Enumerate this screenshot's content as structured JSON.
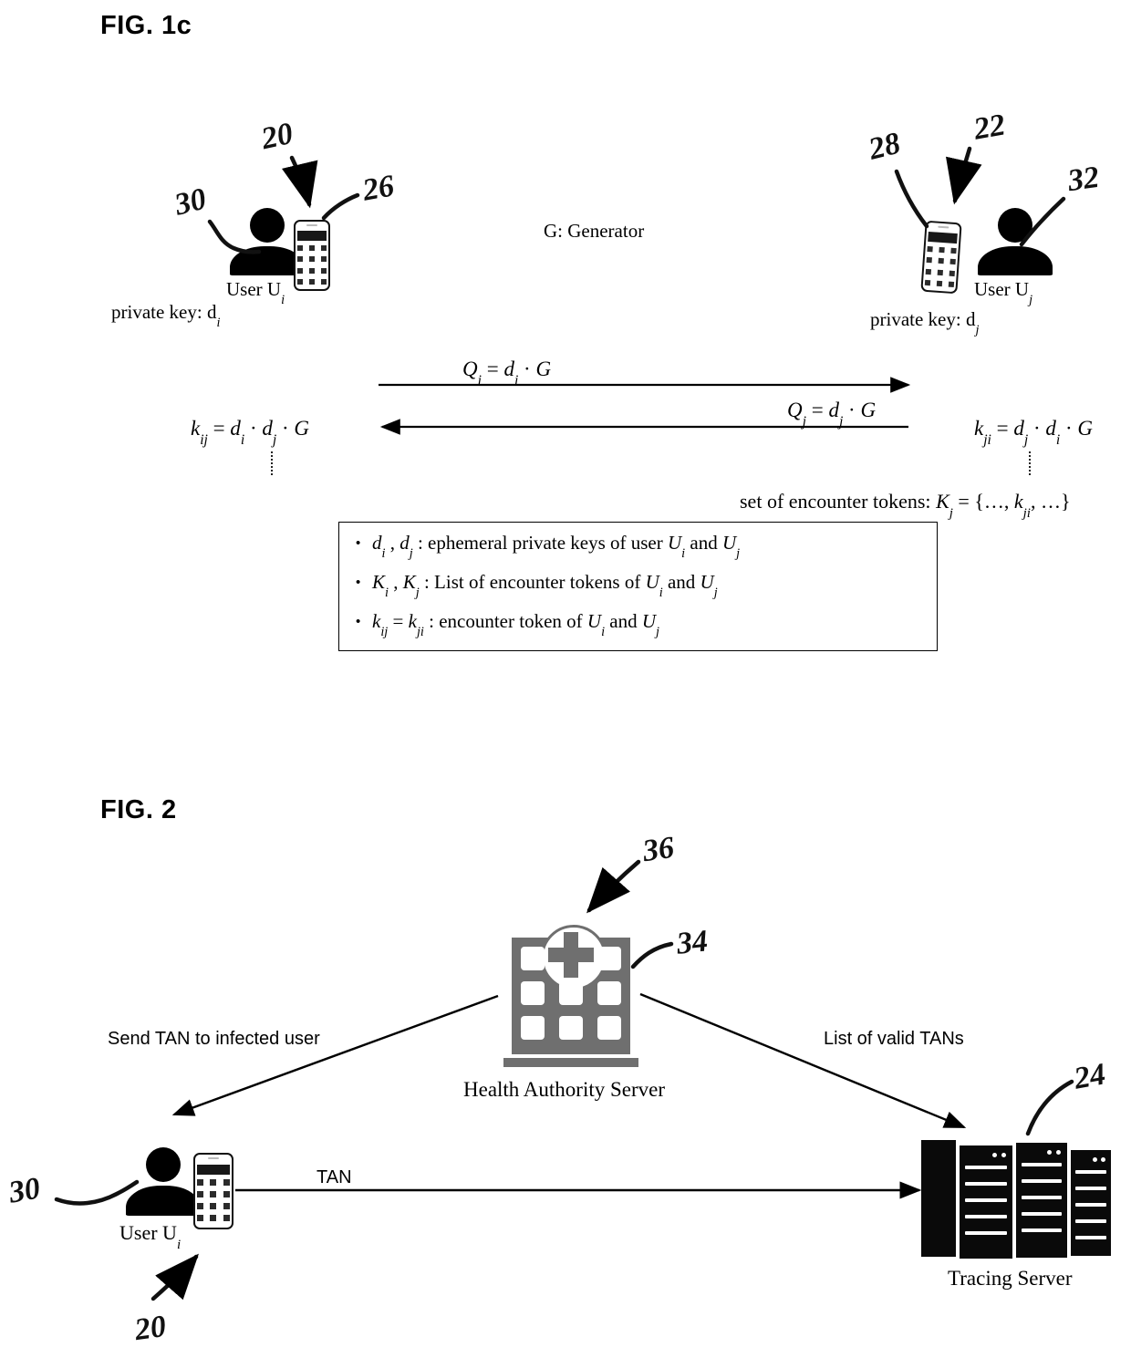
{
  "figures": {
    "fig1c": {
      "title": "FIG. 1c",
      "generator_note": "G: Generator",
      "left_user": {
        "caption": "User U",
        "caption_sub": "i",
        "private_key_label": "private key: d",
        "private_key_sub": "i",
        "ref_person": "30",
        "ref_device": "26",
        "ref_node": "20"
      },
      "right_user": {
        "caption": "User U",
        "caption_sub": "j",
        "private_key_label": "private key: d",
        "private_key_sub": "j",
        "ref_person": "32",
        "ref_device": "28",
        "ref_node": "22"
      },
      "messages": [
        {
          "name": "forward",
          "equation": "Q_i = d_i · G",
          "direction": "right"
        },
        {
          "name": "backward",
          "equation": "Q_j = d_j · G",
          "direction": "left"
        }
      ],
      "derived_left": "k_ij = d_i · d_j · G",
      "derived_right": "k_ji = d_j · d_i · G",
      "token_set_note": "set of encounter tokens: K_j = {…, k_ji, …}",
      "legend": [
        "d_i , d_j : ephemeral private keys of user U_i and U_j",
        "K_i , K_j : List of encounter tokens of U_i and U_j",
        "k_ij = k_ji : encounter token of U_i and U_j"
      ]
    },
    "fig2": {
      "title": "FIG. 2",
      "health_authority": {
        "caption": "Health Authority Server",
        "ref_building": "34",
        "ref_node": "36"
      },
      "tracing_server": {
        "caption": "Tracing Server",
        "ref": "24"
      },
      "user": {
        "caption": "User U",
        "caption_sub": "i",
        "ref_person": "30",
        "ref_node": "20"
      },
      "arrows": [
        {
          "name": "send-tan",
          "label": "Send TAN to infected user"
        },
        {
          "name": "valid-tans",
          "label": "List of valid TANs"
        },
        {
          "name": "tan",
          "label": "TAN"
        }
      ]
    }
  },
  "colors": {
    "ink": "#000000",
    "building_gray": "#6f6f6f",
    "rack_black": "#0a0a0a"
  }
}
